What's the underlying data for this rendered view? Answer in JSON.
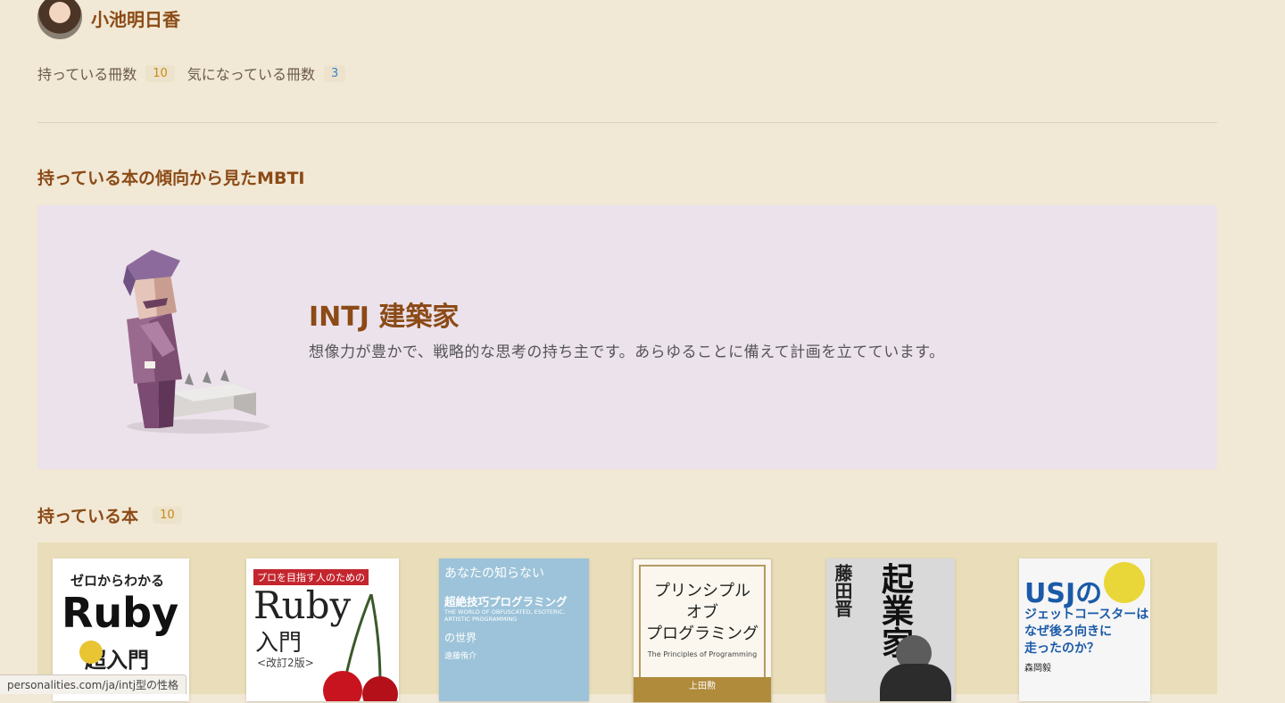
{
  "profile": {
    "name": "小池明日香"
  },
  "counts": {
    "owned_label": "持っている冊数",
    "owned_count": "10",
    "wanted_label": "気になっている冊数",
    "wanted_count": "3"
  },
  "mbti": {
    "section_title": "持っている本の傾向から見たMBTI",
    "type": "INTJ 建築家",
    "description": "想像力が豊かで、戦略的な思考の持ち主です。あらゆることに備えて計画を立てています。"
  },
  "books": {
    "section_title": "持っている本",
    "count": "10",
    "items": [
      {
        "top": "ゼロからわかる",
        "title": "Ruby",
        "sub": "超入門"
      },
      {
        "top": "プロを目指す人のための",
        "title": "Ruby",
        "sub": "入門",
        "edition": "<改訂2版>"
      },
      {
        "top": "あなたの知らない",
        "title": "超絶技巧プログラミング",
        "en": "THE WORLD OF OBFUSCATED, ESOTERIC, ARTISTIC PROGRAMMING",
        "sub": "の世界",
        "author": "遠藤侑介"
      },
      {
        "title": "プリンシプル\nオブ\nプログラミング",
        "en": "The Principles of Programming",
        "author": "上田勲"
      },
      {
        "author": "藤田晋",
        "title": "起業家"
      },
      {
        "title": "USJの",
        "sub": "ジェットコースターは\nなぜ後ろ向きに\n走ったのか？",
        "author": "森岡毅"
      }
    ]
  },
  "status_bar": {
    "url": "personalities.com/ja/intj型の性格"
  }
}
